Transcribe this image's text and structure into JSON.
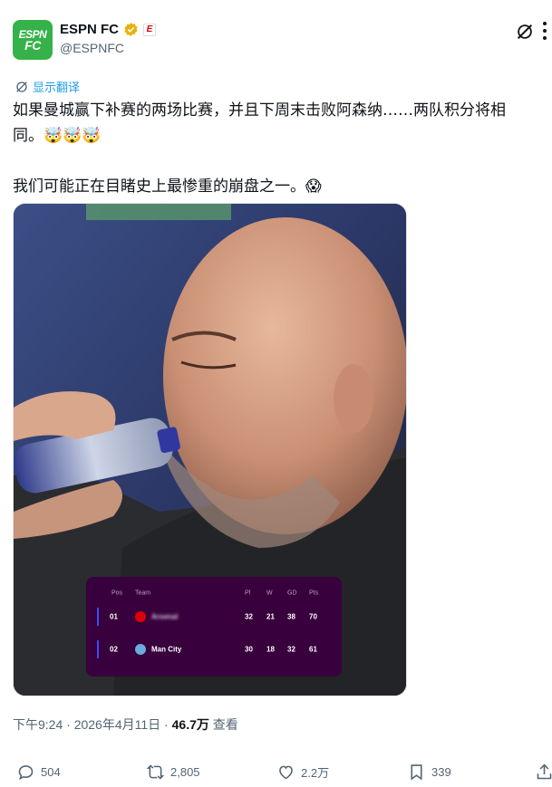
{
  "author": {
    "display_name": "ESPN FC",
    "handle": "@ESPNFC",
    "avatar_line1": "ESPN",
    "avatar_line2": "FC",
    "badge_letter": "E",
    "avatar_color": "#35b24a",
    "verified_color": "#e8b10c"
  },
  "translate_label": "显示翻译",
  "post": {
    "line1": "如果曼城赢下补赛的两场比赛，并且下周末击败阿森纳……两队积分将相",
    "line2": "同。🤯🤯🤯",
    "line3": "我们可能正在目睹史上最惨重的崩盘之一。😱"
  },
  "standings": {
    "headers": {
      "pos": "Pos",
      "team": "Team",
      "pl": "Pl",
      "w": "W",
      "gd": "GD",
      "pts": "Pts"
    },
    "rows": [
      {
        "pos": "01",
        "team": "Arsenal",
        "pl": "32",
        "w": "21",
        "gd": "38",
        "pts": "70"
      },
      {
        "pos": "02",
        "team": "Man City",
        "pl": "30",
        "w": "18",
        "gd": "32",
        "pts": "61"
      }
    ],
    "background": "#38003c"
  },
  "meta": {
    "time": "下午9:24",
    "sep1": " · ",
    "date": "2026年4月11日",
    "sep2": " · ",
    "views": "46.7万",
    "views_label": " 查看"
  },
  "actions": {
    "replies": "504",
    "reposts": "2,805",
    "likes": "2.2万",
    "bookmarks": "339"
  },
  "icons": [
    "verified-icon",
    "grok-icon",
    "more-icon",
    "translate-icon",
    "reply-icon",
    "repost-icon",
    "like-icon",
    "bookmark-icon",
    "share-icon"
  ]
}
